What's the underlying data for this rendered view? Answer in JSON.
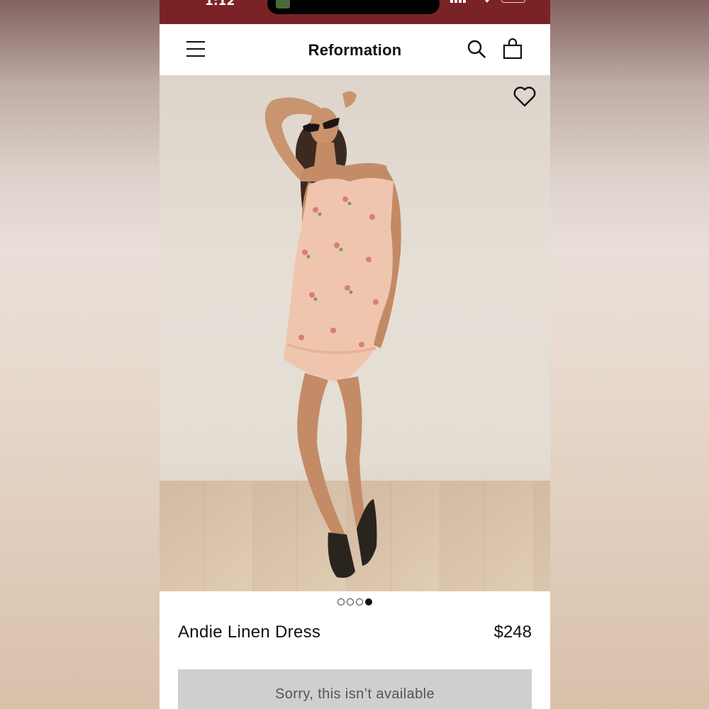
{
  "status_bar": {
    "time": "1:12"
  },
  "nav": {
    "brand": "Reformation",
    "icons": [
      "menu-icon",
      "search-icon",
      "shopping-bag-icon"
    ]
  },
  "product": {
    "image_icon": "heart-icon",
    "carousel": {
      "total": 4,
      "active_index": 3
    },
    "name": "Andie Linen Dress",
    "price": "$248",
    "availability_button": "Sorry, this isn’t available"
  },
  "colors": {
    "status_bar": "#7a2326",
    "button_disabled": "#d0cfcf",
    "text": "#111111"
  }
}
